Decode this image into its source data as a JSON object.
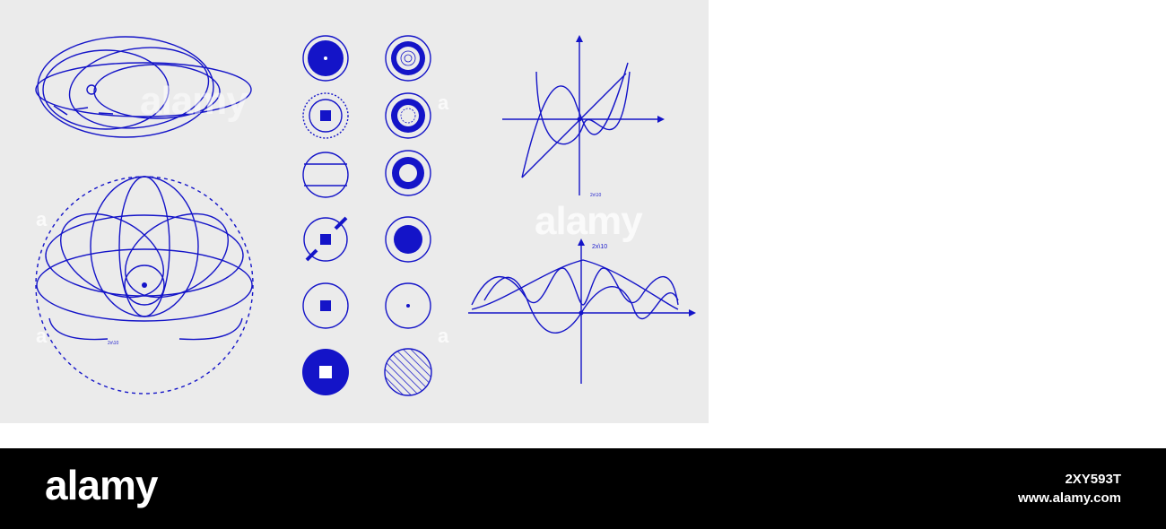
{
  "artwork": {
    "accent_color": "#1414c8",
    "background_color": "#ebebeb",
    "graph_top_label": "2x\\10",
    "graph_bottom_label": "2x\\10",
    "orbit_label": "2x\\10",
    "icon_grid": {
      "left_column": [
        "filled-disc-icon",
        "square-sun-icon",
        "banded-circle-icon",
        "slashed-square-circle-icon",
        "square-in-circle-icon",
        "solid-disc-square-icon"
      ],
      "right_column": [
        "concentric-rings-icon",
        "gear-rings-icon",
        "thick-ring-icon",
        "dot-in-disc-icon",
        "dot-in-circle-icon",
        "hatched-disc-icon"
      ]
    }
  },
  "watermarks": {
    "center": "alamy",
    "top": "alamy",
    "side_mark": "a"
  },
  "footer": {
    "brand": "alamy",
    "image_id": "2XY593T",
    "site": "www.alamy.com"
  }
}
